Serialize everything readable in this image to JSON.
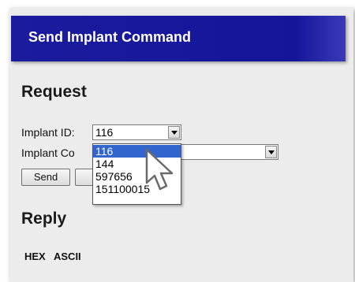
{
  "title": "Send Implant Command",
  "request": {
    "heading": "Request",
    "implant_id_label": "Implant ID:",
    "implant_id_value": "116",
    "implant_command_label": "Implant Co",
    "implant_command_value": "",
    "send_label": "Send",
    "second_button_label": ""
  },
  "dropdown": {
    "options": [
      "116",
      "144",
      "597656",
      "151100015"
    ],
    "selected": "116"
  },
  "reply": {
    "heading": "Reply",
    "columns": [
      "HEX",
      "ASCII"
    ]
  },
  "colors": {
    "title_bar": "#15159a",
    "selection": "#3366cc",
    "panel": "#ececec"
  }
}
